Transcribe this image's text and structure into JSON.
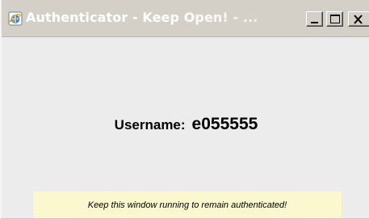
{
  "window": {
    "title": "Authenticator - Keep Open! - ...",
    "icon": "browser-icon",
    "controls": {
      "minimize_icon": "minimize-icon",
      "maximize_icon": "maximize-icon",
      "close_icon": "close-icon"
    }
  },
  "main": {
    "username_label": "Username:",
    "username_value": "e055555"
  },
  "notice": {
    "text": "Keep this window running to remain authenticated!",
    "background_color": "#fbf7cf"
  },
  "colors": {
    "titlebar": "#d4d0c8",
    "content_background": "#ececec"
  }
}
